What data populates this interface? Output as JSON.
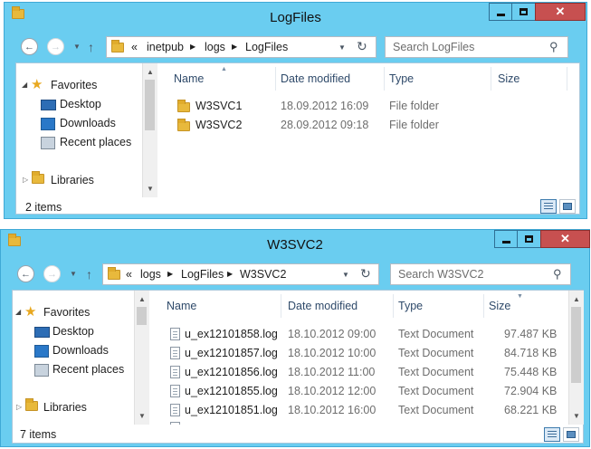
{
  "colors": {
    "frame": "#6acdf0",
    "close": "#c75050"
  },
  "window1": {
    "title": "LogFiles",
    "address": {
      "overflow": "«",
      "crumbs": [
        "inetpub",
        "logs",
        "LogFiles"
      ]
    },
    "search_placeholder": "Search LogFiles",
    "nav": {
      "favorites": "Favorites",
      "desktop": "Desktop",
      "downloads": "Downloads",
      "recent": "Recent places",
      "libraries": "Libraries"
    },
    "columns": {
      "name": "Name",
      "date": "Date modified",
      "type": "Type",
      "size": "Size"
    },
    "rows": [
      {
        "name": "W3SVC1",
        "date": "18.09.2012 16:09",
        "type": "File folder",
        "size": ""
      },
      {
        "name": "W3SVC2",
        "date": "28.09.2012 09:18",
        "type": "File folder",
        "size": ""
      }
    ],
    "status": "2 items"
  },
  "window2": {
    "title": "W3SVC2",
    "address": {
      "overflow": "«",
      "crumbs": [
        "logs",
        "LogFiles",
        "W3SVC2"
      ]
    },
    "search_placeholder": "Search W3SVC2",
    "nav": {
      "favorites": "Favorites",
      "desktop": "Desktop",
      "downloads": "Downloads",
      "recent": "Recent places",
      "libraries": "Libraries"
    },
    "columns": {
      "name": "Name",
      "date": "Date modified",
      "type": "Type",
      "size": "Size"
    },
    "rows": [
      {
        "name": "u_ex12101858.log",
        "date": "18.10.2012 09:00",
        "type": "Text Document",
        "size": "97.487 KB"
      },
      {
        "name": "u_ex12101857.log",
        "date": "18.10.2012 10:00",
        "type": "Text Document",
        "size": "84.718 KB"
      },
      {
        "name": "u_ex12101856.log",
        "date": "18.10.2012 11:00",
        "type": "Text Document",
        "size": "75.448 KB"
      },
      {
        "name": "u_ex12101855.log",
        "date": "18.10.2012 12:00",
        "type": "Text Document",
        "size": "72.904 KB"
      },
      {
        "name": "u_ex12101851.log",
        "date": "18.10.2012 16:00",
        "type": "Text Document",
        "size": "68.221 KB"
      }
    ],
    "status": "7 items"
  }
}
